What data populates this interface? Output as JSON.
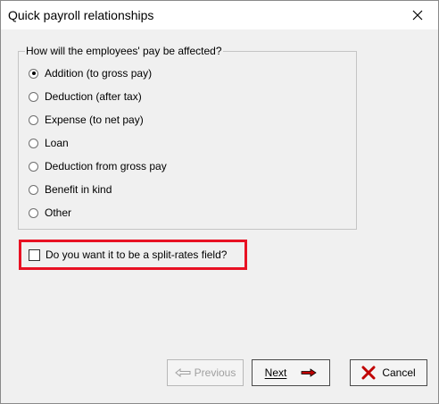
{
  "window": {
    "title": "Quick payroll relationships"
  },
  "group": {
    "legend": "How will the employees' pay be affected?",
    "options": [
      {
        "label": "Addition (to gross pay)",
        "selected": true
      },
      {
        "label": "Deduction (after tax)",
        "selected": false
      },
      {
        "label": "Expense (to net pay)",
        "selected": false
      },
      {
        "label": "Loan",
        "selected": false
      },
      {
        "label": "Deduction from gross pay",
        "selected": false
      },
      {
        "label": "Benefit in kind",
        "selected": false
      },
      {
        "label": "Other",
        "selected": false
      }
    ]
  },
  "split_rates": {
    "label": "Do you want it to be a split-rates field?",
    "checked": false,
    "highlight_color": "#e81123"
  },
  "buttons": {
    "previous": {
      "label": "Previous",
      "enabled": false
    },
    "next": {
      "label": "Next",
      "enabled": true
    },
    "cancel": {
      "label": "Cancel",
      "enabled": true
    }
  },
  "icons": {
    "close": "close-icon",
    "previous": "arrow-left-icon",
    "next": "arrow-right-icon",
    "cancel": "red-x-icon"
  },
  "colors": {
    "next_arrow": "#c00000",
    "cancel_x": "#c00000",
    "disabled_text": "#a0a0a0"
  }
}
